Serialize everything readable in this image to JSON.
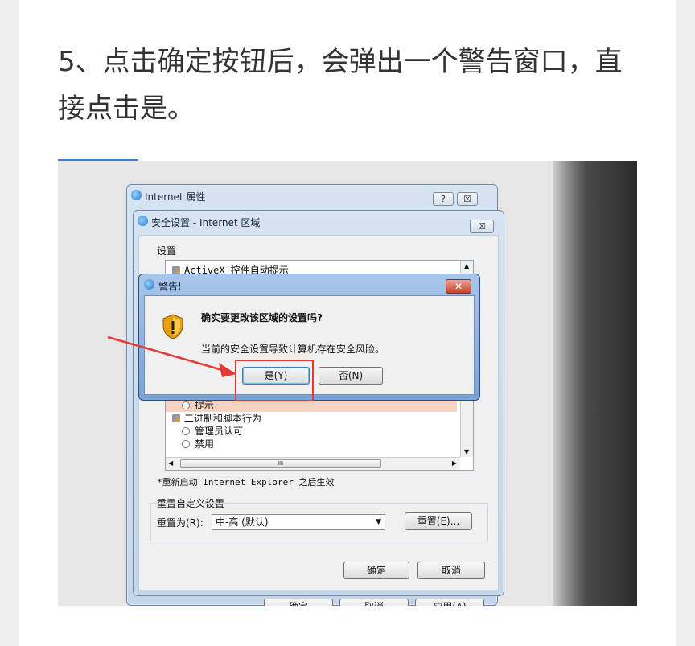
{
  "article": {
    "step_text": "5、点击确定按钮后，会弹出一个警告窗口，直接点击是。"
  },
  "ie_properties": {
    "title": "Internet 属性",
    "help_btn": "?",
    "close_btn": "☒",
    "bottom_buttons": [
      "确定",
      "取消",
      "应用(A)"
    ]
  },
  "security_settings": {
    "title": "安全设置 - Internet 区域",
    "close_btn": "☒",
    "settings_label": "设置",
    "list_items": [
      {
        "kind": "group",
        "label": "ActiveX 控件自动提示"
      },
      {
        "kind": "option",
        "label": "提示"
      },
      {
        "kind": "group",
        "label": "二进制和脚本行为"
      },
      {
        "kind": "option",
        "label": "管理员认可"
      },
      {
        "kind": "option",
        "label": "禁用"
      }
    ],
    "hscroll_mark": "III",
    "restart_note": "*重新启动 Internet Explorer 之后生效",
    "reset_group_label": "重置自定义设置",
    "reset_to_label": "重置为(R):",
    "reset_select_value": "中-高 (默认)",
    "reset_button": "重置(E)...",
    "ok_button": "确定",
    "cancel_button": "取消"
  },
  "warning_dialog": {
    "title": "警告!",
    "close_btn": "✕",
    "question": "确实要更改该区域的设置吗?",
    "detail": "当前的安全设置导致计算机存在安全风险。",
    "yes_button": "是(Y)",
    "no_button": "否(N)"
  },
  "colors": {
    "highlight_red": "#e53935",
    "accent_blue": "#3d7fd6"
  }
}
